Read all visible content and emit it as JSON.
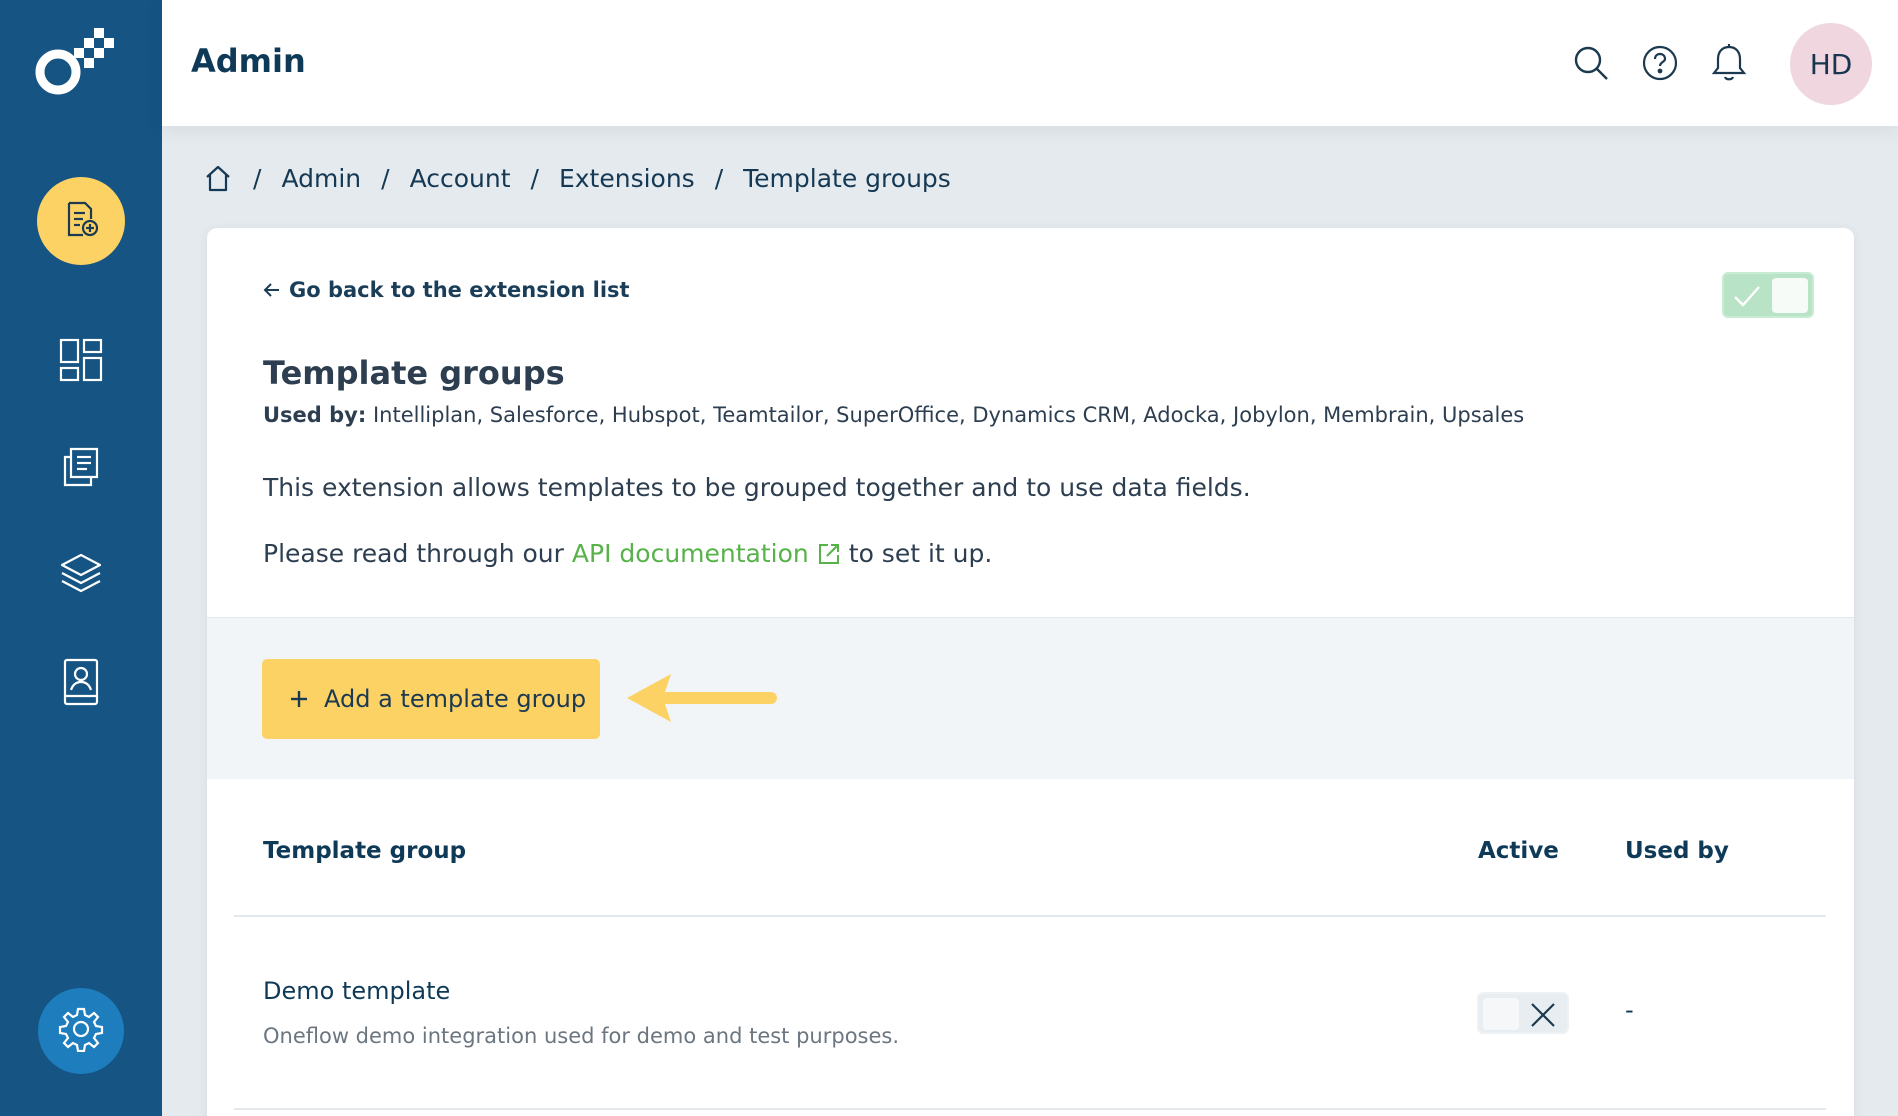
{
  "header": {
    "title": "Admin",
    "avatar_initials": "HD"
  },
  "icons": {
    "search": "search-icon",
    "help": "help-icon",
    "notifications": "bell-icon"
  },
  "sidebar": {
    "items": [
      {
        "name": "create-document",
        "icon": "document-plus-icon"
      },
      {
        "name": "dashboard",
        "icon": "dashboard-icon"
      },
      {
        "name": "documents",
        "icon": "documents-icon"
      },
      {
        "name": "templates",
        "icon": "layers-icon"
      },
      {
        "name": "contacts",
        "icon": "address-book-icon"
      },
      {
        "name": "admin-settings",
        "icon": "gear-icon"
      }
    ]
  },
  "breadcrumb": {
    "items": [
      "Admin",
      "Account",
      "Extensions",
      "Template groups"
    ],
    "separator": "/"
  },
  "card": {
    "back_label": "Go back to the extension list",
    "title": "Template groups",
    "used_by_label": "Used by:",
    "used_by_value": "Intelliplan, Salesforce, Hubspot, Teamtailor, SuperOffice, Dynamics CRM, Adocka, Jobylon, Membrain, Upsales",
    "description": "This extension allows templates to be grouped together and to use data fields.",
    "api_prefix": "Please read through our",
    "api_link": "API documentation",
    "api_suffix": "to set it up.",
    "extension_enabled": true
  },
  "add_button": {
    "label": "Add a template group",
    "icon": "plus-icon"
  },
  "table": {
    "headers": [
      "Template group",
      "Active",
      "Used by"
    ],
    "rows": [
      {
        "title": "Demo template",
        "description": "Oneflow demo integration used for demo and test purposes.",
        "active": false,
        "used_by": "-"
      }
    ]
  },
  "colors": {
    "sidebar": "#155483",
    "accent_yellow": "#fdd265",
    "link_green": "#58b24a",
    "toggle_on": "#b9e3c7"
  }
}
